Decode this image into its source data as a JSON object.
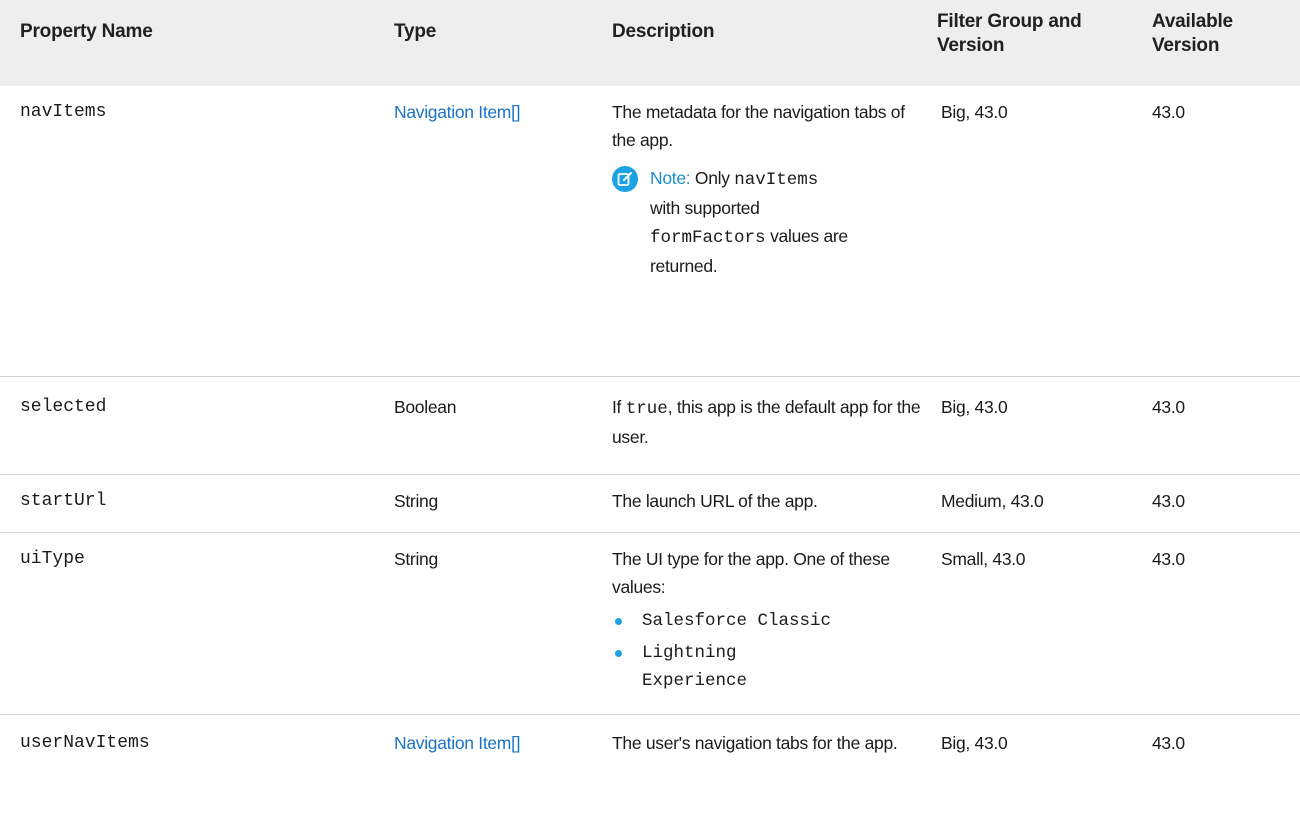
{
  "headers": {
    "property_name": "Property Name",
    "type": "Type",
    "description": "Description",
    "filter_group_version": "Filter Group and Version",
    "available_version": "Available Version"
  },
  "rows": [
    {
      "property": "navItems",
      "type": "Navigation Item[]",
      "description": "The metadata for the navigation tabs of the app.",
      "note": {
        "label": "Note:",
        "text_1": "Only",
        "code_1": "navItems",
        "text_2": "with supported",
        "code_2": "formFactors",
        "text_3": "values are returned."
      },
      "filter_group": "Big, 43.0",
      "available": "43.0"
    },
    {
      "property": "selected",
      "type": "Boolean",
      "description_prefix": "If",
      "description_code": "true",
      "description_suffix": ", this app is the default app for the user.",
      "filter_group": "Big, 43.0",
      "available": "43.0"
    },
    {
      "property": "startUrl",
      "type": "String",
      "description": "The launch URL of the app.",
      "filter_group": "Medium, 43.0",
      "available": "43.0"
    },
    {
      "property": "uiType",
      "type": "String",
      "description": "The UI type for the app. One of these values:",
      "values": [
        "Salesforce Classic",
        "Lightning Experience"
      ],
      "filter_group": "Small, 43.0",
      "available": "43.0"
    },
    {
      "property": "userNavItems",
      "type": "Navigation Item[]",
      "description": "The user's navigation tabs for the app.",
      "filter_group": "Big, 43.0",
      "available": "43.0"
    }
  ],
  "colors": {
    "link": "#1a73c7",
    "accent": "#1da1e5",
    "header_bg": "#eeeeee",
    "border": "#d4d4d4"
  },
  "icons": {
    "note": "note-edit-icon",
    "bullet": "bullet-dot-icon"
  }
}
